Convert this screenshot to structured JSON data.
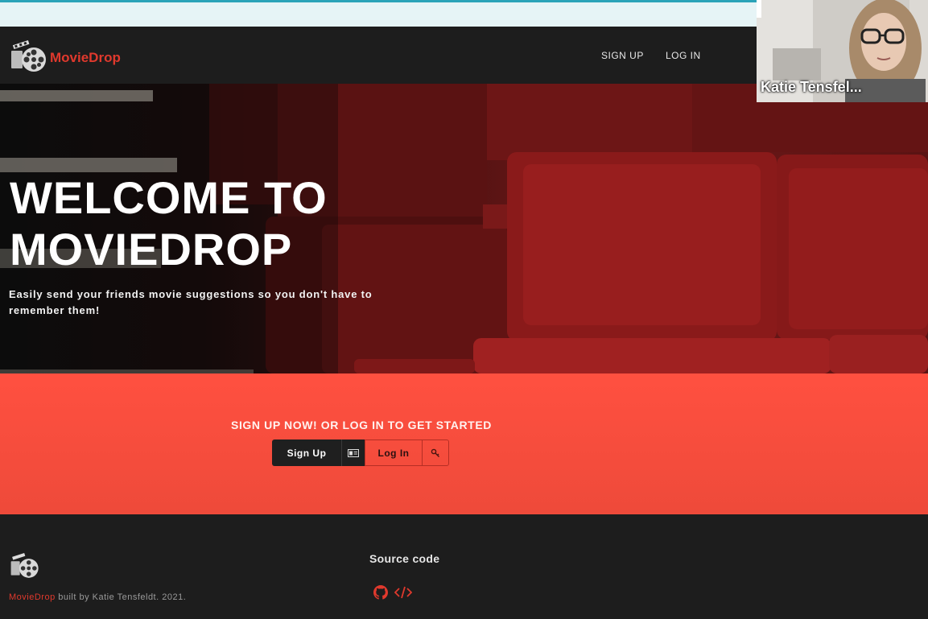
{
  "navbar": {
    "brand": "MovieDrop",
    "links": {
      "signup": "SIGN UP",
      "login": "LOG IN"
    }
  },
  "hero": {
    "title": "WELCOME TO MOVIEDROP",
    "subtitle": "Easily send your friends movie suggestions so you don't have to remember them!"
  },
  "cta": {
    "heading": "SIGN UP NOW! OR LOG IN TO GET STARTED",
    "signup_label": "Sign Up",
    "login_label": "Log In"
  },
  "footer": {
    "brand": "MovieDrop",
    "credit": "built by Katie Tensfeldt. 2021.",
    "source_title": "Source code"
  },
  "video": {
    "participant_name": "Katie Tensfel..."
  },
  "colors": {
    "accent_red": "#e0392d",
    "cta_bg": "#ff5040",
    "dark": "#1d1d1d"
  }
}
